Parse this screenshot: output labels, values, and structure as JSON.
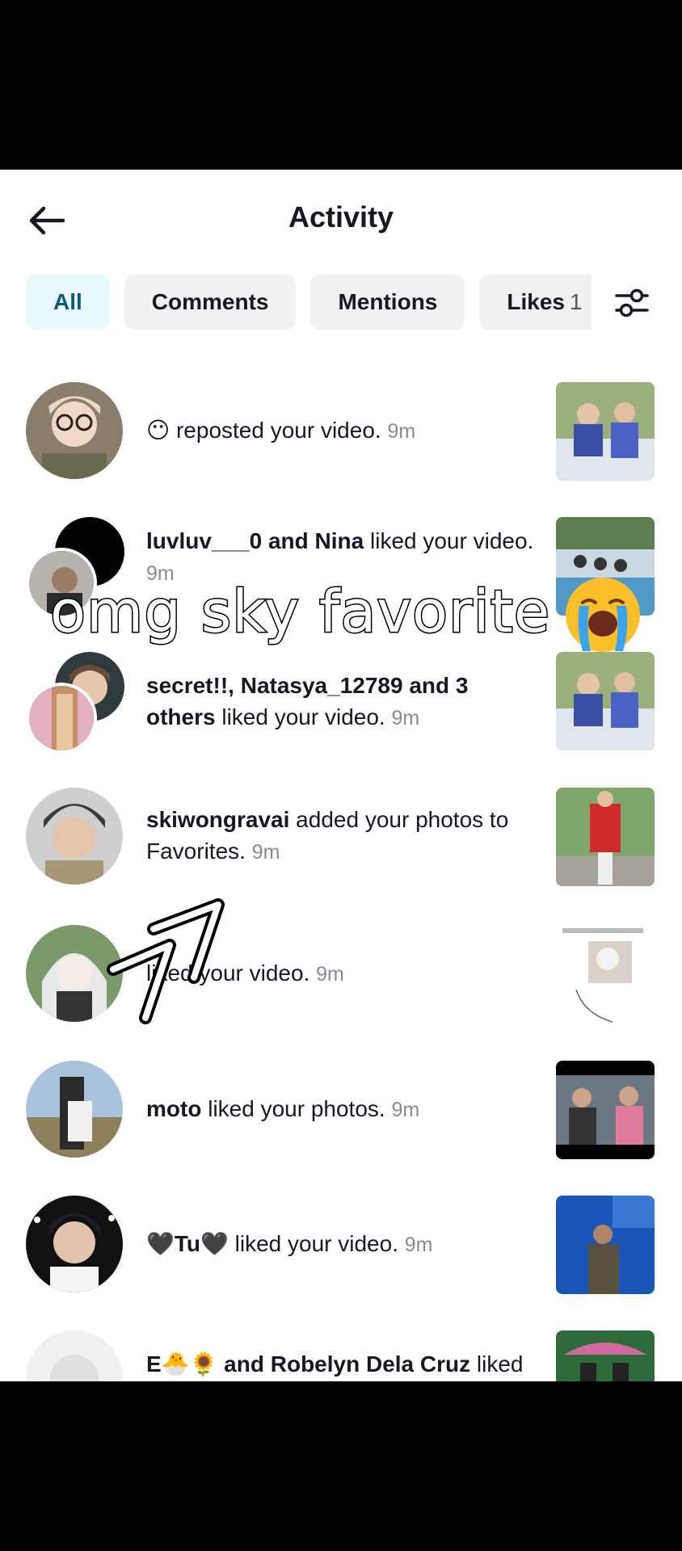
{
  "header": {
    "title": "Activity"
  },
  "tabs": [
    {
      "label": "All",
      "active": true
    },
    {
      "label": "Comments"
    },
    {
      "label": "Mentions"
    },
    {
      "label": "Likes",
      "count": "1"
    }
  ],
  "items": [
    {
      "pre": "😶 ",
      "bold": "",
      "action": "reposted your video.",
      "time": "9m"
    },
    {
      "pre": "",
      "bold": "luvluv___0 and Nina",
      "action": " liked your video.",
      "time": "9m"
    },
    {
      "pre": "",
      "bold": "secret!!, Natasya_12789 and 3 others",
      "action": " liked your video.",
      "time": "9m"
    },
    {
      "pre": "",
      "bold": "skiwongravai",
      "action": " added your photos to Favorites.",
      "time": "9m"
    },
    {
      "pre": "",
      "bold": "",
      "action": "liked your video.",
      "time": "9m"
    },
    {
      "pre": "",
      "bold": "moto",
      "action": " liked your photos.",
      "time": "9m"
    },
    {
      "pre": "",
      "bold": "🖤Tu🖤",
      "action": " liked your video.",
      "time": "9m"
    },
    {
      "pre": "",
      "bold": "E🐣🌻 and Robelyn Dela Cruz",
      "action": " liked",
      "time": ""
    }
  ],
  "overlay": {
    "caption": "omg sky favorite",
    "emoji": "loudly-crying-face"
  },
  "colors": {
    "accent_tab_bg": "#e8f8fd",
    "accent_tab_text": "#0b5b78",
    "tab_bg": "#f1f1f2",
    "time": "#8a8b91"
  }
}
